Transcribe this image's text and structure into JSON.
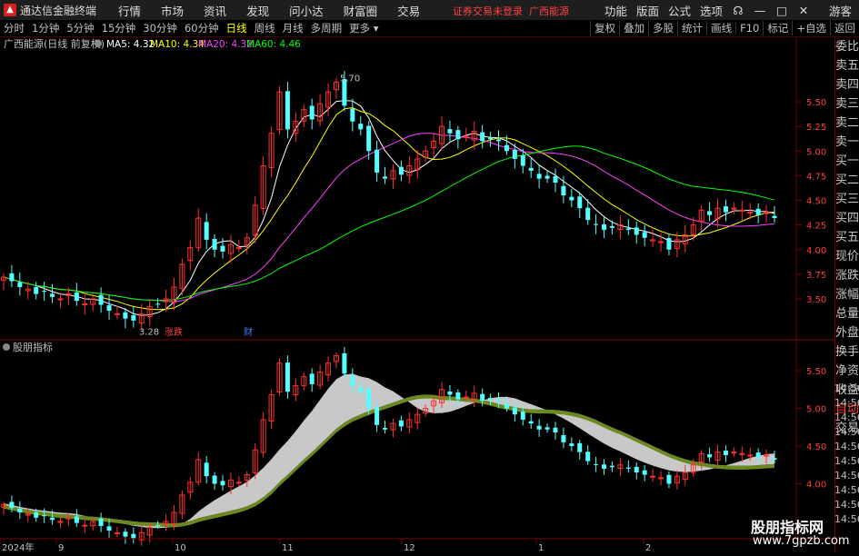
{
  "titlebar": {
    "app_name": "通达信金融终端",
    "menu": [
      "行情",
      "市场",
      "资讯",
      "发现",
      "问小达",
      "财富圈",
      "交易"
    ],
    "login_status": "证券交易未登录",
    "stock_name": "广西能源",
    "right_menu": [
      "功能",
      "版面",
      "公式",
      "选项"
    ],
    "guest": "游客"
  },
  "toolbar": {
    "periods": [
      "分时",
      "1分钟",
      "5分钟",
      "15分钟",
      "30分钟",
      "60分钟",
      "日线",
      "周线",
      "月线",
      "多周期",
      "更多"
    ],
    "active_period": "日线",
    "tools": [
      "复权",
      "叠加",
      "多股",
      "统计",
      "画线",
      "F10",
      "标记",
      "+自选",
      "返回"
    ]
  },
  "main_chart": {
    "header": "广西能源(日线 前复权)",
    "ma": [
      {
        "label": "MA5: 4.32",
        "color": "#ffffff"
      },
      {
        "label": "MA10: 4.34",
        "color": "#ffff00"
      },
      {
        "label": "MA20: 4.32",
        "color": "#ff40ff"
      },
      {
        "label": "MA60: 4.46",
        "color": "#00ff00"
      }
    ],
    "y_ticks": [
      "5.50",
      "5.25",
      "5.00",
      "4.75",
      "4.50",
      "4.25",
      "4.00",
      "3.75",
      "3.50"
    ],
    "high_label": "5.70",
    "low_label": "3.28",
    "markers": [
      {
        "text": "涨跌"
      },
      {
        "text": "财"
      }
    ]
  },
  "sub_chart": {
    "header": "股朋指标",
    "y_ticks": [
      "5.50",
      "5.00",
      "4.50",
      "4.00"
    ]
  },
  "x_axis": [
    "2024年",
    "9",
    "10",
    "11",
    "12",
    "1",
    "2"
  ],
  "side_panel": {
    "items": [
      "委比",
      "卖五",
      "卖四",
      "卖三",
      "卖二",
      "卖一",
      "买一",
      "买二",
      "买三",
      "买四",
      "买五",
      "现价",
      "涨跌",
      "涨幅",
      "总量",
      "外盘",
      "换手",
      "净资",
      "收益"
    ],
    "auto": "自动",
    "trade": "交易",
    "times": [
      "14:56",
      "14:56",
      "14:56",
      "14:56",
      "14:56",
      "14:56",
      "14:56",
      "14:56",
      "14:56",
      "14:56"
    ]
  },
  "watermark": {
    "line1": "股朋指标网",
    "line2": "www.7gpzb.com"
  },
  "chart_data": {
    "type": "candlestick",
    "title": "广西能源(日线 前复权)",
    "closes": [
      3.72,
      3.68,
      3.62,
      3.6,
      3.55,
      3.58,
      3.52,
      3.5,
      3.55,
      3.48,
      3.45,
      3.5,
      3.44,
      3.38,
      3.35,
      3.3,
      3.28,
      3.35,
      3.42,
      3.45,
      3.5,
      3.62,
      3.85,
      4.02,
      4.32,
      4.1,
      4.0,
      3.98,
      4.05,
      4.02,
      4.12,
      4.45,
      4.85,
      5.18,
      5.6,
      5.22,
      5.3,
      5.42,
      5.32,
      5.48,
      5.6,
      5.7,
      5.46,
      5.3,
      5.22,
      5.0,
      4.78,
      4.72,
      4.8,
      4.76,
      4.85,
      4.92,
      5.0,
      5.1,
      5.25,
      5.18,
      5.12,
      5.15,
      5.2,
      5.1,
      5.12,
      5.1,
      5.0,
      4.92,
      4.85,
      4.8,
      4.72,
      4.72,
      4.68,
      4.55,
      4.5,
      4.42,
      4.3,
      4.25,
      4.2,
      4.22,
      4.25,
      4.2,
      4.15,
      4.12,
      4.1,
      4.08,
      4.0,
      4.1,
      4.15,
      4.25,
      4.4,
      4.35,
      4.42,
      4.38,
      4.42,
      4.4,
      4.38,
      4.35,
      4.38,
      4.32
    ],
    "ylim": [
      3.25,
      5.75
    ],
    "high": 5.7,
    "low": 3.28,
    "series": [
      {
        "name": "MA5",
        "last": 4.32
      },
      {
        "name": "MA10",
        "last": 4.34
      },
      {
        "name": "MA20",
        "last": 4.32
      },
      {
        "name": "MA60",
        "last": 4.46
      }
    ]
  }
}
